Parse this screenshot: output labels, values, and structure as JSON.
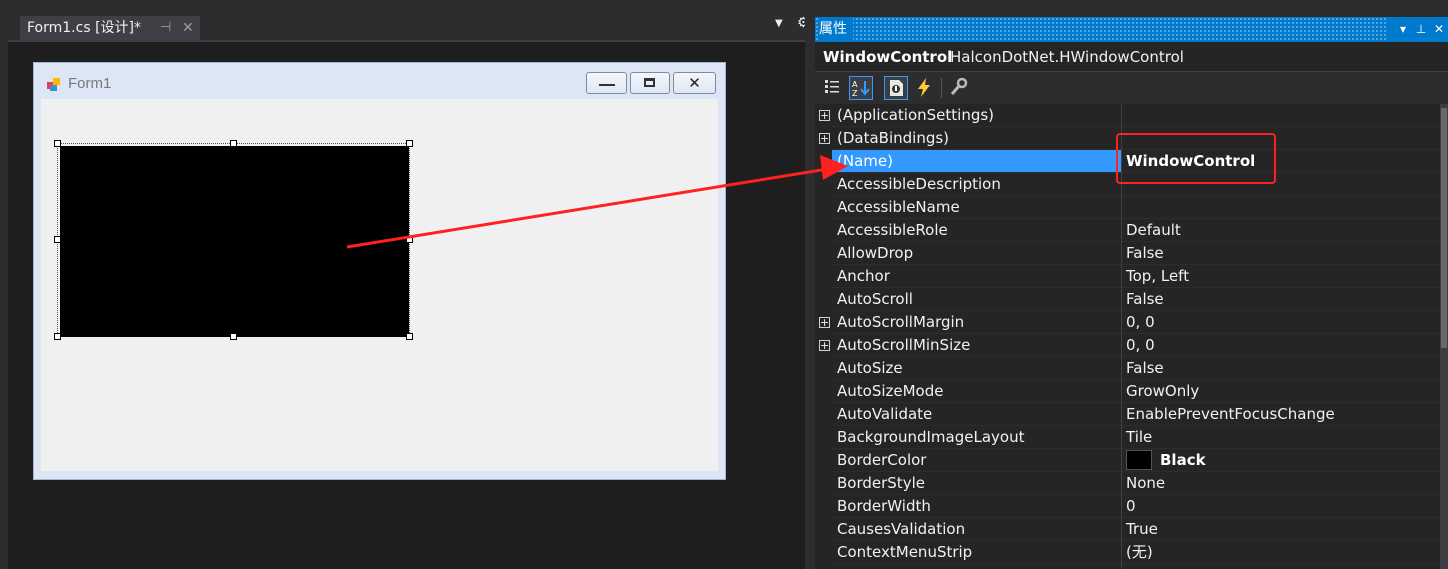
{
  "document_tab": {
    "title": "Form1.cs [设计]*",
    "pin_glyph": "⊣",
    "close_glyph": "✕"
  },
  "tab_controls": {
    "dropdown_glyph": "▼",
    "gear_glyph": "⚙"
  },
  "form": {
    "title": "Form1",
    "minimize_glyph": "—",
    "maximize_glyph": "▢",
    "close_glyph": "✕",
    "control": {
      "name": "WindowControl",
      "background": "#000000"
    }
  },
  "properties": {
    "title": "属性",
    "title_controls": [
      "▾",
      "⊥",
      "✕"
    ],
    "object_name": "WindowControl",
    "object_type": "HalconDotNet.HWindowControl",
    "toolbar": [
      {
        "name": "categorized-icon",
        "active": false
      },
      {
        "name": "alphabetical-icon",
        "active": true
      },
      {
        "name": "properties-icon",
        "active": true
      },
      {
        "name": "events-icon",
        "active": false
      },
      {
        "name": "property-pages-icon",
        "active": false
      }
    ],
    "rows": [
      {
        "name": "(ApplicationSettings)",
        "value": "",
        "expandable": true
      },
      {
        "name": "(DataBindings)",
        "value": "",
        "expandable": true
      },
      {
        "name": "(Name)",
        "value": "WindowControl",
        "selected": true,
        "bold": true
      },
      {
        "name": "AccessibleDescription",
        "value": ""
      },
      {
        "name": "AccessibleName",
        "value": ""
      },
      {
        "name": "AccessibleRole",
        "value": "Default"
      },
      {
        "name": "AllowDrop",
        "value": "False"
      },
      {
        "name": "Anchor",
        "value": "Top, Left"
      },
      {
        "name": "AutoScroll",
        "value": "False"
      },
      {
        "name": "AutoScrollMargin",
        "value": "0, 0",
        "expandable": true
      },
      {
        "name": "AutoScrollMinSize",
        "value": "0, 0",
        "expandable": true
      },
      {
        "name": "AutoSize",
        "value": "False"
      },
      {
        "name": "AutoSizeMode",
        "value": "GrowOnly"
      },
      {
        "name": "AutoValidate",
        "value": "EnablePreventFocusChange"
      },
      {
        "name": "BackgroundImageLayout",
        "value": "Tile"
      },
      {
        "name": "BorderColor",
        "value": "Black",
        "swatch": "#000000",
        "bold": true
      },
      {
        "name": "BorderStyle",
        "value": "None"
      },
      {
        "name": "BorderWidth",
        "value": "0"
      },
      {
        "name": "CausesValidation",
        "value": "True"
      },
      {
        "name": "ContextMenuStrip",
        "value": "(无)"
      }
    ]
  },
  "colors": {
    "accent": "#007acc",
    "selection": "#3399ff",
    "annotation": "#ff2020"
  }
}
